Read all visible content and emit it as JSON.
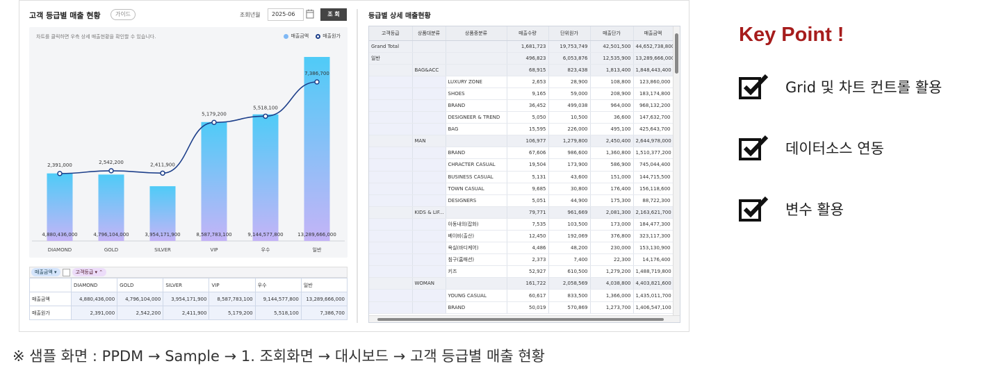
{
  "left_panel": {
    "title": "고객 등급별 매출 현황",
    "guide_label": "가이드",
    "date_label": "조회년월",
    "date_value": "2025-06",
    "search_label": "조 회",
    "chart_note": "차트를 클릭하면 우측 상세 매출현황을 확인할 수 있습니다.",
    "legend_amount": "매출금액",
    "legend_cost": "매출원가"
  },
  "chart_data": {
    "type": "bar",
    "categories": [
      "DIAMOND",
      "GOLD",
      "SILVER",
      "VIP",
      "우수",
      "일반"
    ],
    "series": [
      {
        "name": "매출금액",
        "type": "bar",
        "values": [
          4880436000,
          4796104000,
          3954171900,
          8587783100,
          9144577800,
          13289666000
        ],
        "labels": [
          "4,880,436,000",
          "4,796,104,000",
          "3,954,171,900",
          "8,587,783,100",
          "9,144,577,800",
          "13,289,666,000"
        ]
      },
      {
        "name": "매출원가",
        "type": "line",
        "values": [
          2391000,
          2542200,
          2411900,
          5179200,
          5518100,
          7386700
        ],
        "labels": [
          "2,391,000",
          "2,542,200",
          "2,411,900",
          "5,179,200",
          "5,518,100",
          "7,386,700"
        ]
      }
    ],
    "bar_color_top": "#4fcbf7",
    "bar_color_bottom": "#c4b4f7",
    "line_color": "#1d3f8a"
  },
  "pivot_left": {
    "chip_measure": "매출금액",
    "chip_grade": "고객등급",
    "header": [
      "Measures",
      "DIAMOND",
      "GOLD",
      "SILVER",
      "VIP",
      "우수",
      "일반"
    ],
    "rows": [
      [
        "매출금액",
        "4,880,436,000",
        "4,796,104,000",
        "3,954,171,900",
        "8,587,783,100",
        "9,144,577,800",
        "13,289,666,000"
      ],
      [
        "매출원가",
        "2,391,000",
        "2,542,200",
        "2,411,900",
        "5,179,200",
        "5,518,100",
        "7,386,700"
      ]
    ]
  },
  "right_panel": {
    "title": "등급별 상세 매출현황",
    "columns": [
      "고객등급",
      "상품대분류",
      "상품중분류",
      "매출수량",
      "단위원가",
      "매출단가",
      "매출금액"
    ],
    "rows": [
      {
        "c1": "Grand Total",
        "c2": "",
        "c3": "",
        "v": [
          "1,681,723",
          "19,753,749",
          "42,501,500",
          "44,652,738,800"
        ],
        "sub": true
      },
      {
        "c1": "일반",
        "c2": "",
        "c3": "",
        "v": [
          "496,823",
          "6,053,876",
          "12,535,900",
          "13,289,666,000"
        ],
        "sub": true
      },
      {
        "c1": "",
        "c2": "BAG&ACC",
        "c3": "",
        "v": [
          "68,915",
          "823,438",
          "1,813,400",
          "1,848,443,400"
        ],
        "sub": true
      },
      {
        "c1": "",
        "c2": "",
        "c3": "LUXURY ZONE",
        "v": [
          "2,653",
          "28,900",
          "108,800",
          "123,860,000"
        ]
      },
      {
        "c1": "",
        "c2": "",
        "c3": "SHOES",
        "v": [
          "9,165",
          "59,000",
          "208,900",
          "183,174,800"
        ]
      },
      {
        "c1": "",
        "c2": "",
        "c3": "BRAND",
        "v": [
          "36,452",
          "499,038",
          "964,000",
          "968,132,200"
        ]
      },
      {
        "c1": "",
        "c2": "",
        "c3": "DESIGNEER & TREND",
        "v": [
          "5,050",
          "10,500",
          "36,600",
          "147,632,700"
        ]
      },
      {
        "c1": "",
        "c2": "",
        "c3": "BAG",
        "v": [
          "15,595",
          "226,000",
          "495,100",
          "425,643,700"
        ]
      },
      {
        "c1": "",
        "c2": "MAN",
        "c3": "",
        "v": [
          "106,977",
          "1,279,800",
          "2,450,400",
          "2,644,978,000"
        ],
        "sub": true
      },
      {
        "c1": "",
        "c2": "",
        "c3": "BRAND",
        "v": [
          "67,606",
          "986,600",
          "1,360,800",
          "1,510,377,200"
        ]
      },
      {
        "c1": "",
        "c2": "",
        "c3": "CHRACTER CASUAL",
        "v": [
          "19,504",
          "173,900",
          "586,900",
          "745,044,400"
        ]
      },
      {
        "c1": "",
        "c2": "",
        "c3": "BUSINESS CASUAL",
        "v": [
          "5,131",
          "43,600",
          "151,000",
          "144,715,500"
        ]
      },
      {
        "c1": "",
        "c2": "",
        "c3": "TOWN CASUAL",
        "v": [
          "9,685",
          "30,800",
          "176,400",
          "156,118,600"
        ]
      },
      {
        "c1": "",
        "c2": "",
        "c3": "DESIGNERS",
        "v": [
          "5,051",
          "44,900",
          "175,300",
          "88,722,300"
        ]
      },
      {
        "c1": "",
        "c2": "KIDS & LIF...",
        "c3": "",
        "v": [
          "79,771",
          "961,669",
          "2,081,300",
          "2,163,621,700"
        ],
        "sub": true
      },
      {
        "c1": "",
        "c2": "",
        "c3": "아동내의(잡화)",
        "v": [
          "7,535",
          "103,500",
          "173,000",
          "184,477,300"
        ]
      },
      {
        "c1": "",
        "c2": "",
        "c3": "베이비(출산)",
        "v": [
          "12,450",
          "192,069",
          "376,800",
          "323,117,300"
        ]
      },
      {
        "c1": "",
        "c2": "",
        "c3": "욕실(바디케어)",
        "v": [
          "4,486",
          "48,200",
          "230,000",
          "153,130,900"
        ]
      },
      {
        "c1": "",
        "c2": "",
        "c3": "침구(홈패션)",
        "v": [
          "2,373",
          "7,400",
          "22,300",
          "14,176,400"
        ]
      },
      {
        "c1": "",
        "c2": "",
        "c3": "키즈",
        "v": [
          "52,927",
          "610,500",
          "1,279,200",
          "1,488,719,800"
        ]
      },
      {
        "c1": "",
        "c2": "WOMAN",
        "c3": "",
        "v": [
          "161,722",
          "2,058,569",
          "4,038,800",
          "4,403,821,600"
        ],
        "sub": true
      },
      {
        "c1": "",
        "c2": "",
        "c3": "YOUNG CASUAL",
        "v": [
          "60,617",
          "833,500",
          "1,366,000",
          "1,435,011,700"
        ]
      },
      {
        "c1": "",
        "c2": "",
        "c3": "BRAND",
        "v": [
          "50,019",
          "570,869",
          "1,273,700",
          "1,406,547,100"
        ]
      }
    ]
  },
  "key_point": {
    "title": "Key Point !",
    "items": [
      "Grid 및 차트 컨트롤 활용",
      "데이터소스 연동",
      "변수 활용"
    ]
  },
  "footer": "※ 샘플 화면 : PPDM → Sample → 1. 조회화면 → 대시보드 → 고객 등급별 매출 현황"
}
